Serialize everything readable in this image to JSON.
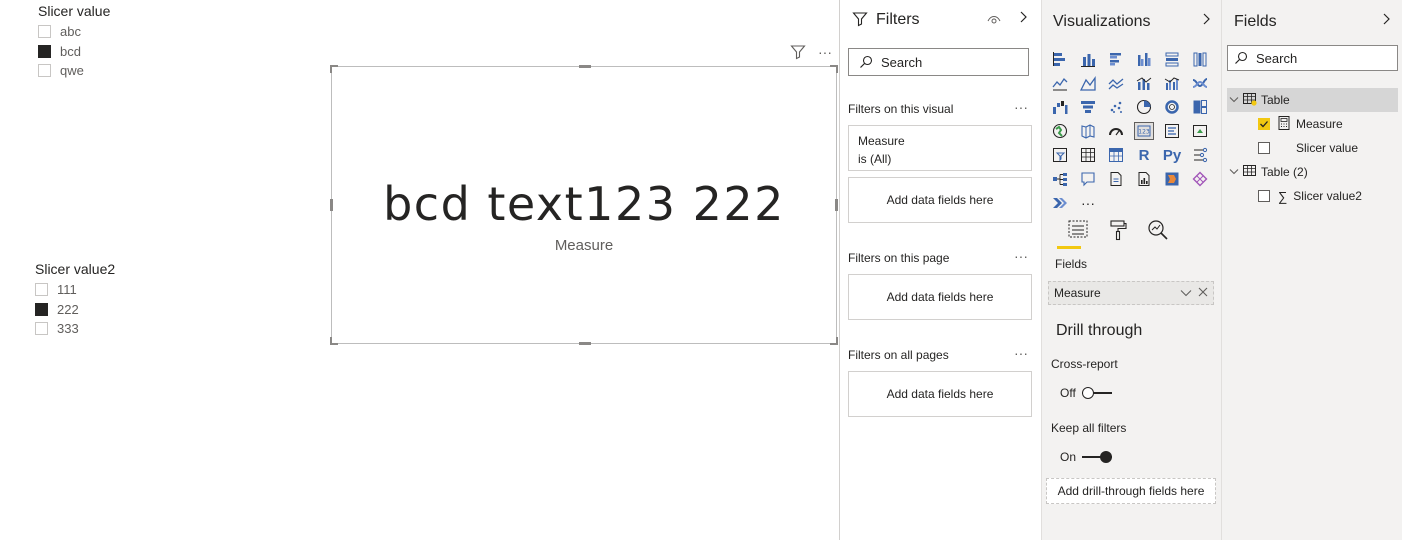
{
  "slicer1": {
    "title": "Slicer value",
    "items": [
      {
        "label": "abc",
        "checked": false
      },
      {
        "label": "bcd",
        "checked": true
      },
      {
        "label": "qwe",
        "checked": false
      }
    ]
  },
  "slicer2": {
    "title": "Slicer value2",
    "items": [
      {
        "label": "111",
        "checked": false
      },
      {
        "label": "222",
        "checked": true
      },
      {
        "label": "333",
        "checked": false
      }
    ]
  },
  "card": {
    "value": "bcd text123 222",
    "label": "Measure"
  },
  "filters": {
    "title": "Filters",
    "search_placeholder": "Search",
    "visual_section": "Filters on this visual",
    "filter_field": "Measure",
    "filter_condition": "is (All)",
    "page_section": "Filters on this page",
    "all_section": "Filters on all pages",
    "add_fields": "Add data fields here",
    "more": "···"
  },
  "viz": {
    "title": "Visualizations",
    "more_visuals": "···",
    "r_label": "R",
    "py_label": "Py",
    "fields_label": "Fields",
    "field_chip": "Measure",
    "drill_title": "Drill through",
    "cross_report": "Cross-report",
    "cross_report_state": "Off",
    "keep_filters": "Keep all filters",
    "keep_filters_state": "On",
    "drill_well": "Add drill-through fields here"
  },
  "fields": {
    "title": "Fields",
    "search_placeholder": "Search",
    "tables": [
      {
        "name": "Table",
        "fields": [
          {
            "name": "Measure",
            "checked": true
          },
          {
            "name": "Slicer value",
            "checked": false
          }
        ]
      },
      {
        "name": "Table (2)",
        "fields": [
          {
            "name": "Slicer value2",
            "checked": false
          }
        ]
      }
    ]
  },
  "colors": {
    "accent": "#f2c811",
    "viz_blue": "#3b66ad",
    "pane_bg": "#f3f2f1"
  }
}
